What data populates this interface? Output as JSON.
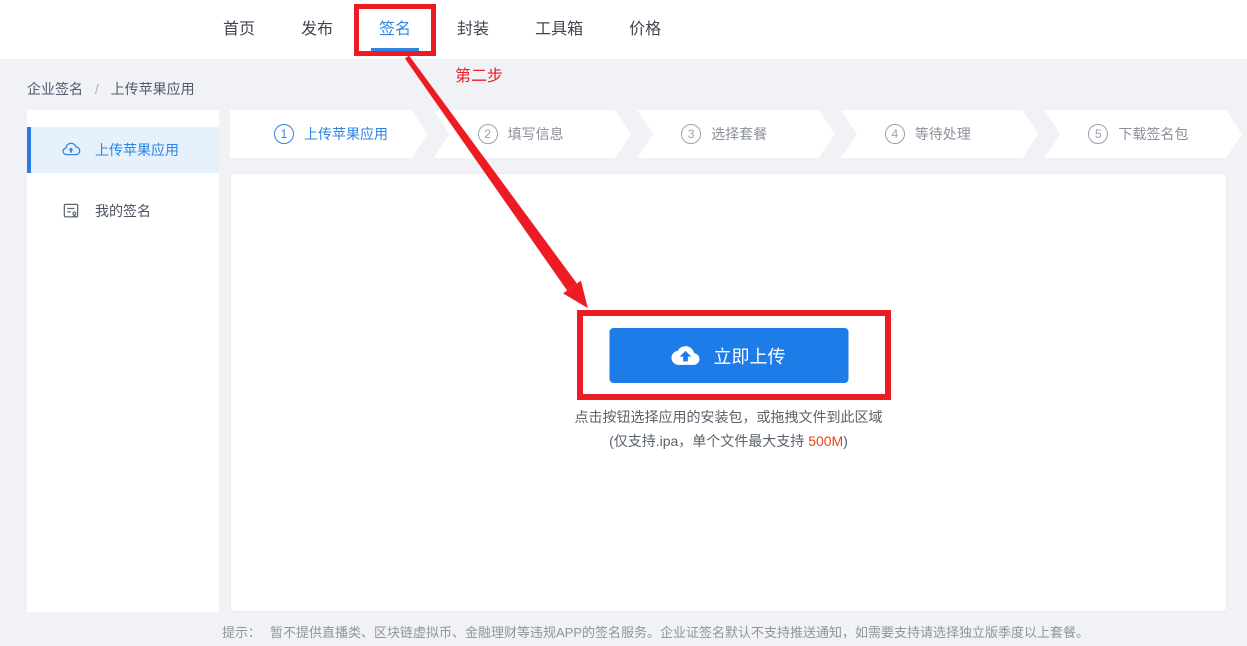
{
  "colors": {
    "accent": "#2b85e4",
    "button-blue": "#1e7ce8",
    "annotation-red": "#ed1c24",
    "warn-red": "#ed4014",
    "page-bg": "#f0f2f5"
  },
  "nav": {
    "items": [
      {
        "label": "首页"
      },
      {
        "label": "发布"
      },
      {
        "label": "签名",
        "active": true
      },
      {
        "label": "封装"
      },
      {
        "label": "工具箱"
      },
      {
        "label": "价格"
      }
    ]
  },
  "annotations": {
    "step_label": "第二步"
  },
  "breadcrumb": {
    "root": "企业签名",
    "separator": "/",
    "current": "上传苹果应用"
  },
  "sidebar": {
    "items": [
      {
        "label": "上传苹果应用",
        "icon": "cloud-upload-icon",
        "active": true
      },
      {
        "label": "我的签名",
        "icon": "signature-document-icon",
        "active": false
      }
    ]
  },
  "steps": [
    {
      "num": "1",
      "label": "上传苹果应用",
      "active": true
    },
    {
      "num": "2",
      "label": "填写信息",
      "active": false
    },
    {
      "num": "3",
      "label": "选择套餐",
      "active": false
    },
    {
      "num": "4",
      "label": "等待处理",
      "active": false
    },
    {
      "num": "5",
      "label": "下载签名包",
      "active": false
    }
  ],
  "upload": {
    "button_label": "立即上传",
    "hint_line1": "点击按钮选择应用的安装包，或拖拽文件到此区域",
    "hint_line2_prefix": "(仅支持.ipa，单个文件最大支持 ",
    "hint_size": "500M",
    "hint_line2_suffix": ")"
  },
  "footer": {
    "tip_label": "提示：",
    "tip_text": "暂不提供直播类、区块链虚拟币、金融理财等违规APP的签名服务。企业证签名默认不支持推送通知，如需要支持请选择独立版季度以上套餐。"
  }
}
